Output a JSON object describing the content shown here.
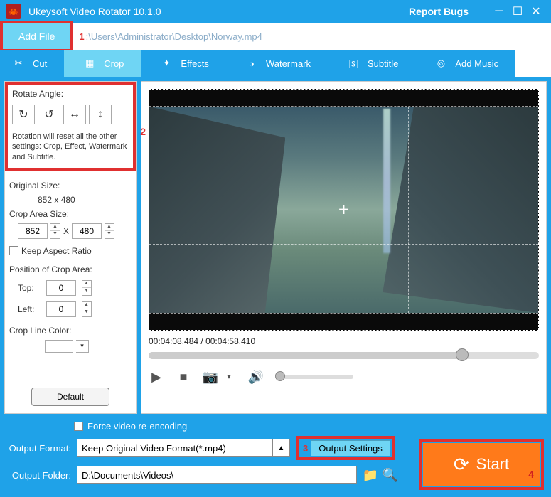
{
  "titlebar": {
    "title": "Ukeysoft Video Rotator 10.1.0",
    "report": "Report Bugs"
  },
  "filebar": {
    "add_file": "Add File",
    "annotation": "1",
    "path": ":\\Users\\Administrator\\Desktop\\Norway.mp4"
  },
  "tabs": {
    "cut": "Cut",
    "crop": "Crop",
    "effects": "Effects",
    "watermark": "Watermark",
    "subtitle": "Subtitle",
    "add_music": "Add Music",
    "active": "crop"
  },
  "left": {
    "rotate_label": "Rotate Angle:",
    "rotate_note": "Rotation will reset all the other settings: Crop, Effect, Watermark and Subtitle.",
    "annotation": "2",
    "original_size_label": "Original Size:",
    "original_size_value": "852 x 480",
    "crop_area_label": "Crop Area Size:",
    "crop_w": "852",
    "crop_h": "480",
    "crop_x_sep": "X",
    "keep_aspect": "Keep Aspect Ratio",
    "position_label": "Position of Crop Area:",
    "top_label": "Top:",
    "top_value": "0",
    "left_label": "Left:",
    "left_value": "0",
    "crop_line_color_label": "Crop Line Color:",
    "default_btn": "Default"
  },
  "preview": {
    "timecode": "00:04:08.484 / 00:04:58.410"
  },
  "bottom": {
    "force_label": "Force video re-encoding",
    "output_format_label": "Output Format:",
    "output_format_value": "Keep Original Video Format(*.mp4)",
    "output_settings": "Output Settings",
    "ann3": "3",
    "output_folder_label": "Output Folder:",
    "output_folder_value": "D:\\Documents\\Videos\\",
    "start": "Start",
    "ann4": "4"
  }
}
